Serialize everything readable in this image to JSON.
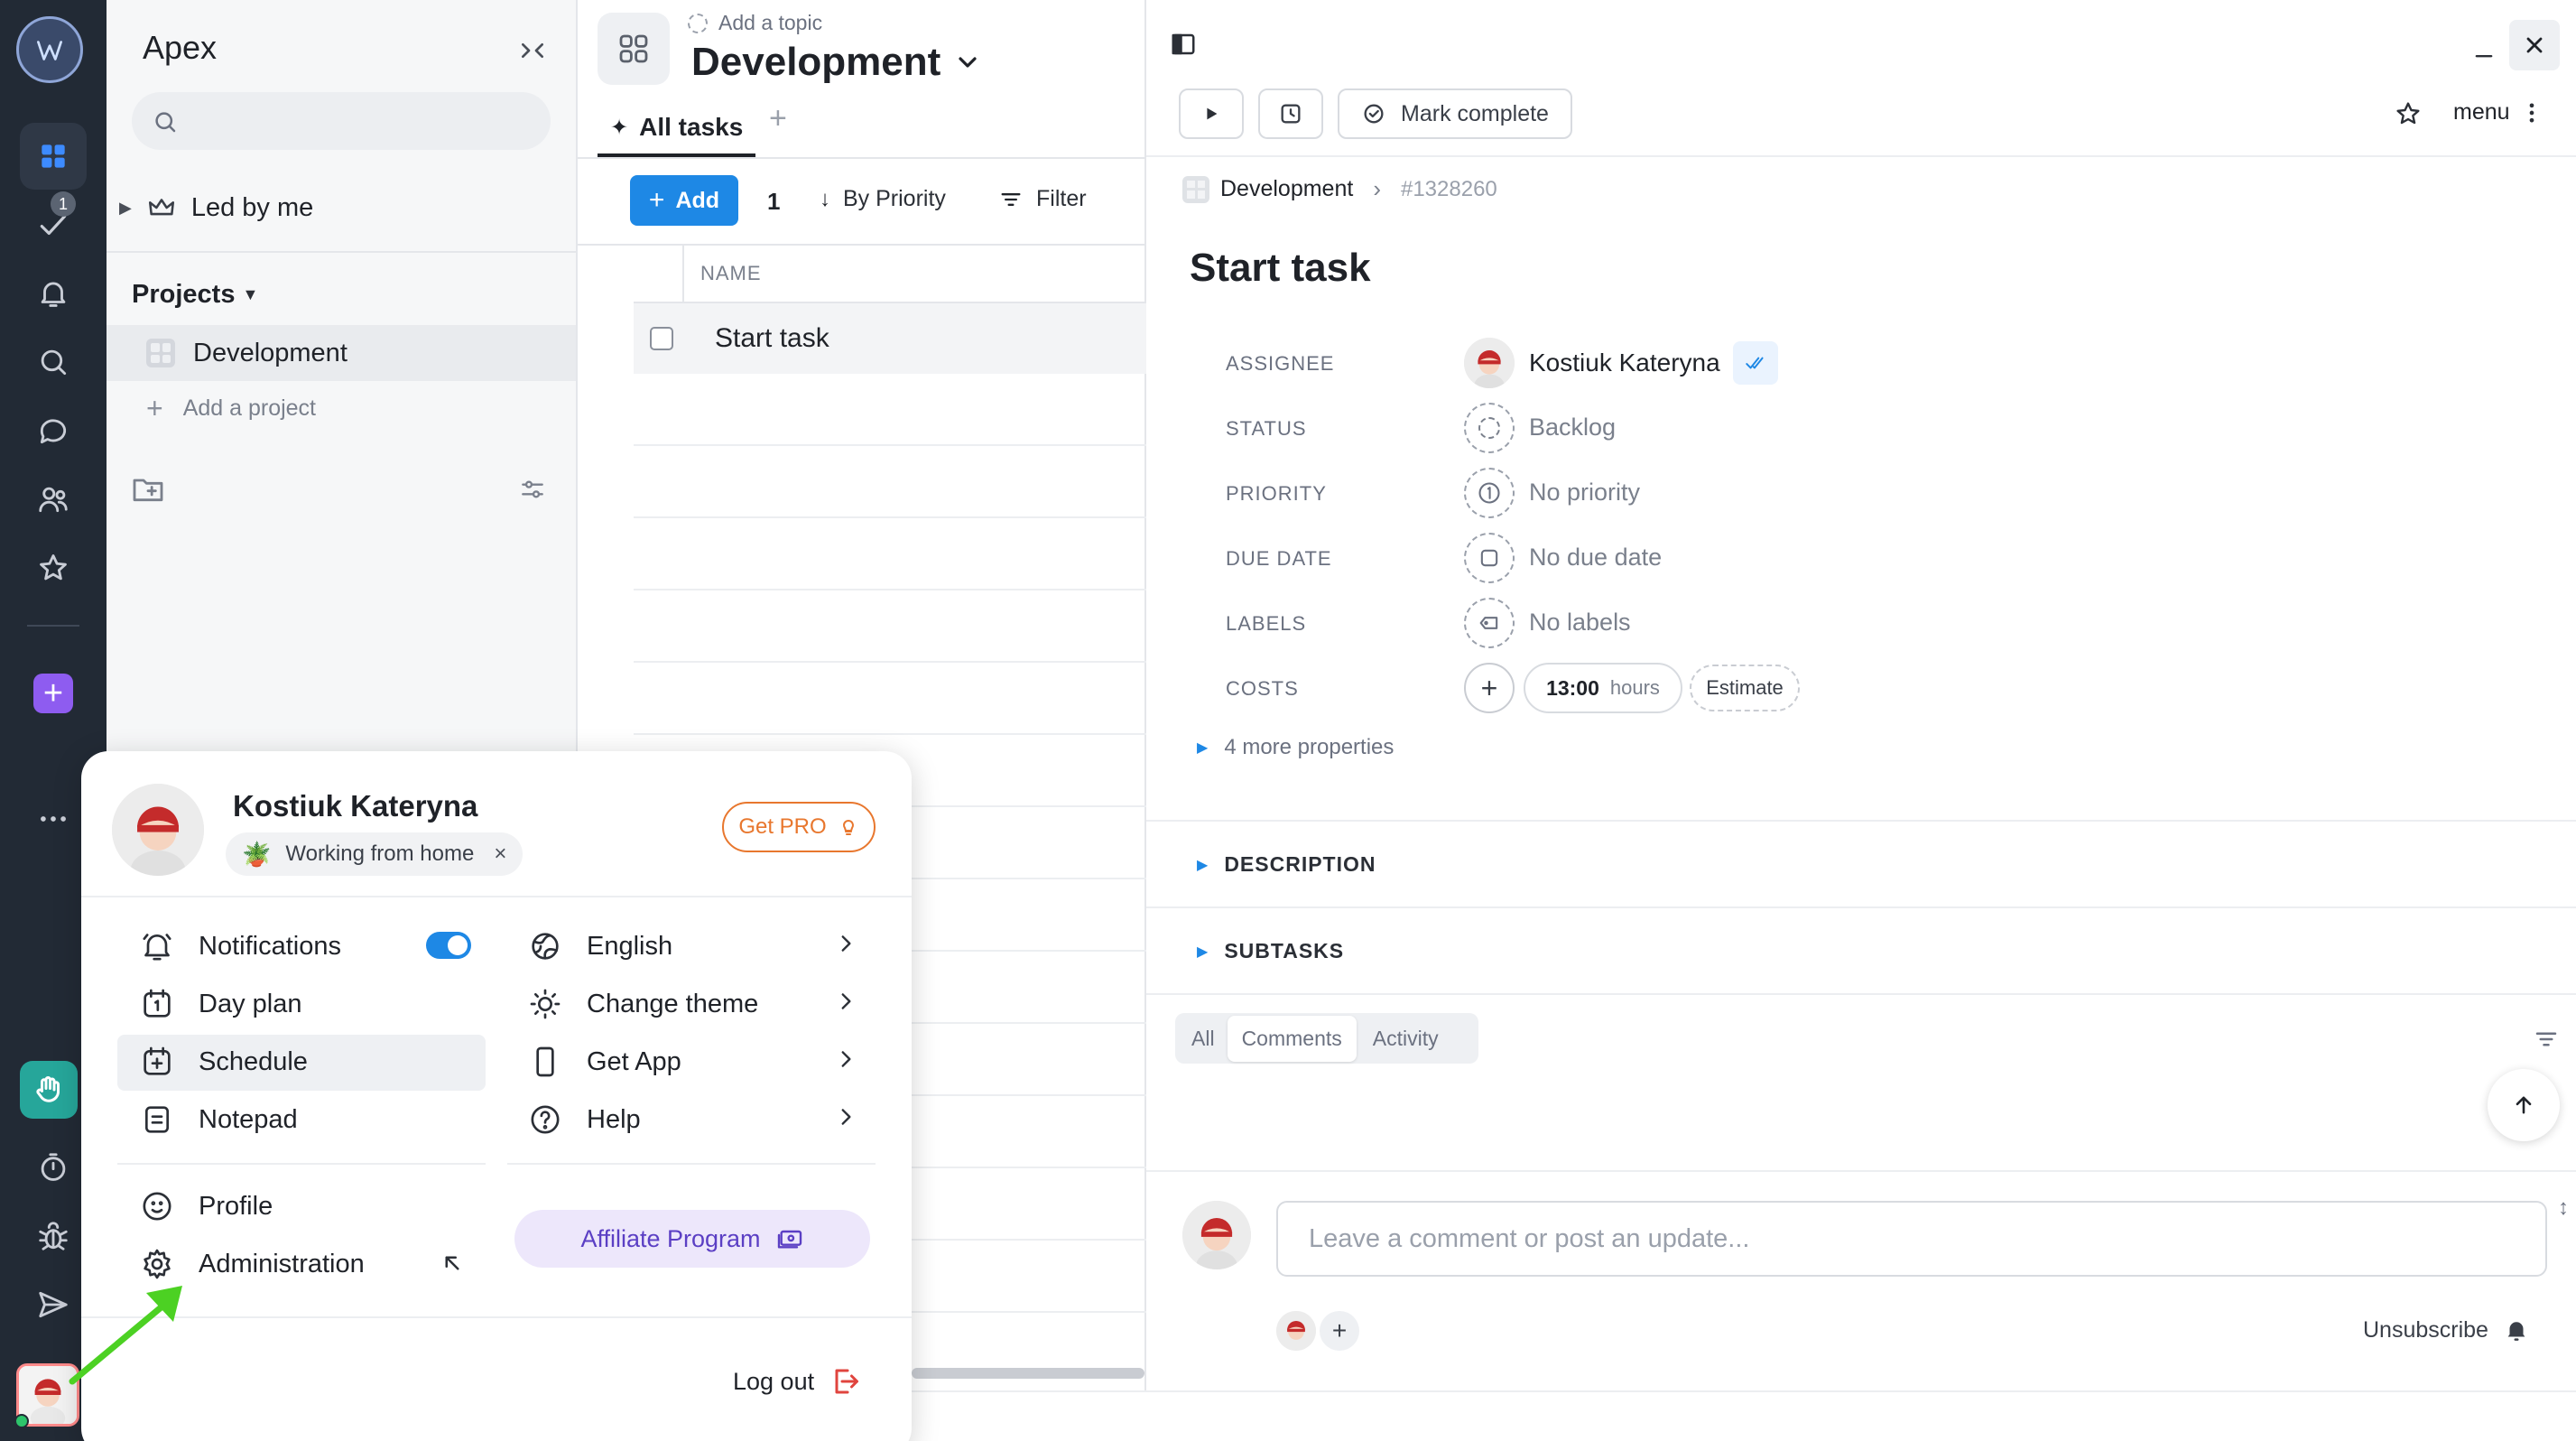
{
  "rail": {
    "badge_count": "1"
  },
  "sidebar": {
    "workspace_name": "Apex",
    "search_placeholder": "",
    "led_by_me": "Led by me",
    "projects_heading": "Projects",
    "projects": [
      {
        "label": "Development"
      }
    ],
    "add_project": "Add a project"
  },
  "tasks": {
    "add_topic": "Add a topic",
    "project_title": "Development",
    "tab_all": "All tasks",
    "add_label": "Add",
    "count": "1",
    "sort_label": "By Priority",
    "filter_label": "Filter",
    "col_name": "NAME",
    "rows": [
      {
        "name": "Start task"
      }
    ]
  },
  "detail": {
    "mark_complete": "Mark complete",
    "menu_label": "menu",
    "breadcrumb_project": "Development",
    "task_id": "#1328260",
    "title": "Start task",
    "props": {
      "assignee_label": "ASSIGNEE",
      "assignee": "Kostiuk Kateryna",
      "status_label": "STATUS",
      "status": "Backlog",
      "priority_label": "PRIORITY",
      "priority": "No priority",
      "due_label": "DUE DATE",
      "due": "No due date",
      "labels_label": "LABELS",
      "labels": "No labels",
      "costs_label": "COSTS",
      "cost_time": "13:00",
      "cost_unit": "hours",
      "estimate": "Estimate"
    },
    "more_properties": "4 more properties",
    "description": "DESCRIPTION",
    "subtasks": "SUBTASKS",
    "feed_tabs": [
      "All",
      "Comments",
      "Activity"
    ],
    "comment_placeholder": "Leave a comment or post an update...",
    "unsubscribe": "Unsubscribe"
  },
  "popup": {
    "user_name": "Kostiuk Kateryna",
    "status_text": "Working from home",
    "get_pro": "Get PRO",
    "left_items": [
      "Notifications",
      "Day plan",
      "Schedule",
      "Notepad"
    ],
    "right_items": [
      "English",
      "Change theme",
      "Get App",
      "Help"
    ],
    "profile": "Profile",
    "administration": "Administration",
    "affiliate": "Affiliate Program",
    "logout": "Log out",
    "notifications_on": true
  },
  "colors": {
    "accent": "#1e88e5",
    "rail_bg": "#222a35",
    "pro_orange": "#e8772e",
    "affiliate_bg": "#ede7fb",
    "affiliate_text": "#5b3fc4",
    "arrow_green": "#4cd123",
    "logout_red": "#e0443e"
  }
}
